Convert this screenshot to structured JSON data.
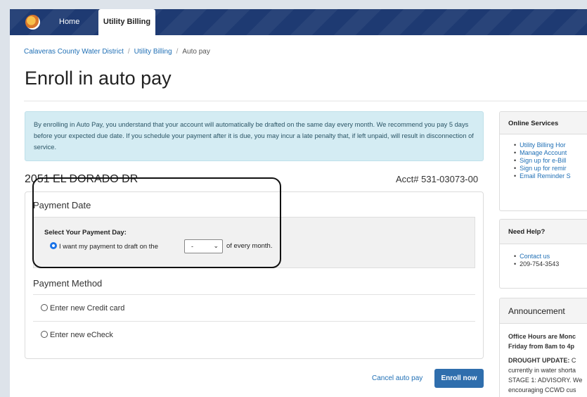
{
  "nav": {
    "home": "Home",
    "active_tab": "Utility Billing"
  },
  "breadcrumb": [
    "Calaveras County Water District",
    "Utility Billing",
    "Auto pay"
  ],
  "page_title": "Enroll in auto pay",
  "info_text": "By enrolling in Auto Pay, you understand that your account will automatically be drafted on the same day every month. We recommend you pay 5 days before your expected due date. If you schedule your payment after it is due, you may incur a late penalty that, if left unpaid, will result in disconnection of service.",
  "account": {
    "address": "2051 EL DORADO DR",
    "number": "Acct# 531-03073-00"
  },
  "payment_date": {
    "title": "Payment Date",
    "label": "Select Your Payment Day:",
    "option_before": "I want my payment to draft on the",
    "selected_day": "-",
    "option_after": "of every month."
  },
  "payment_method": {
    "title": "Payment Method",
    "options": [
      "Enter new Credit card",
      "Enter new eCheck"
    ]
  },
  "actions": {
    "cancel": "Cancel auto pay",
    "enroll": "Enroll now"
  },
  "sidebar": {
    "online_services": {
      "title": "Online Services",
      "items": [
        "Utility Billing Hor",
        "Manage Account",
        "Sign up for e-Bill",
        "Sign up for remir",
        "Email Reminder S"
      ]
    },
    "need_help": {
      "title": "Need Help?",
      "items": [
        "Contact us",
        "209-754-3543"
      ]
    },
    "announcement": {
      "title": "Announcement",
      "hours_line1": "Office Hours are Monc",
      "hours_line2": "Friday from 8am to 4p",
      "drought_label": "DROUGHT UPDATE:",
      "drought_line1_rest": " C",
      "drought_line2": "currently in water shorta",
      "drought_line3": "STAGE 1: ADVISORY. We",
      "drought_line4": "encouraging CCWD cus"
    }
  },
  "colors": {
    "nav_bg": "#1e3a72",
    "primary_button": "#2f6ead",
    "info_bg": "#d4ecf3",
    "link": "#1f6fb5"
  }
}
